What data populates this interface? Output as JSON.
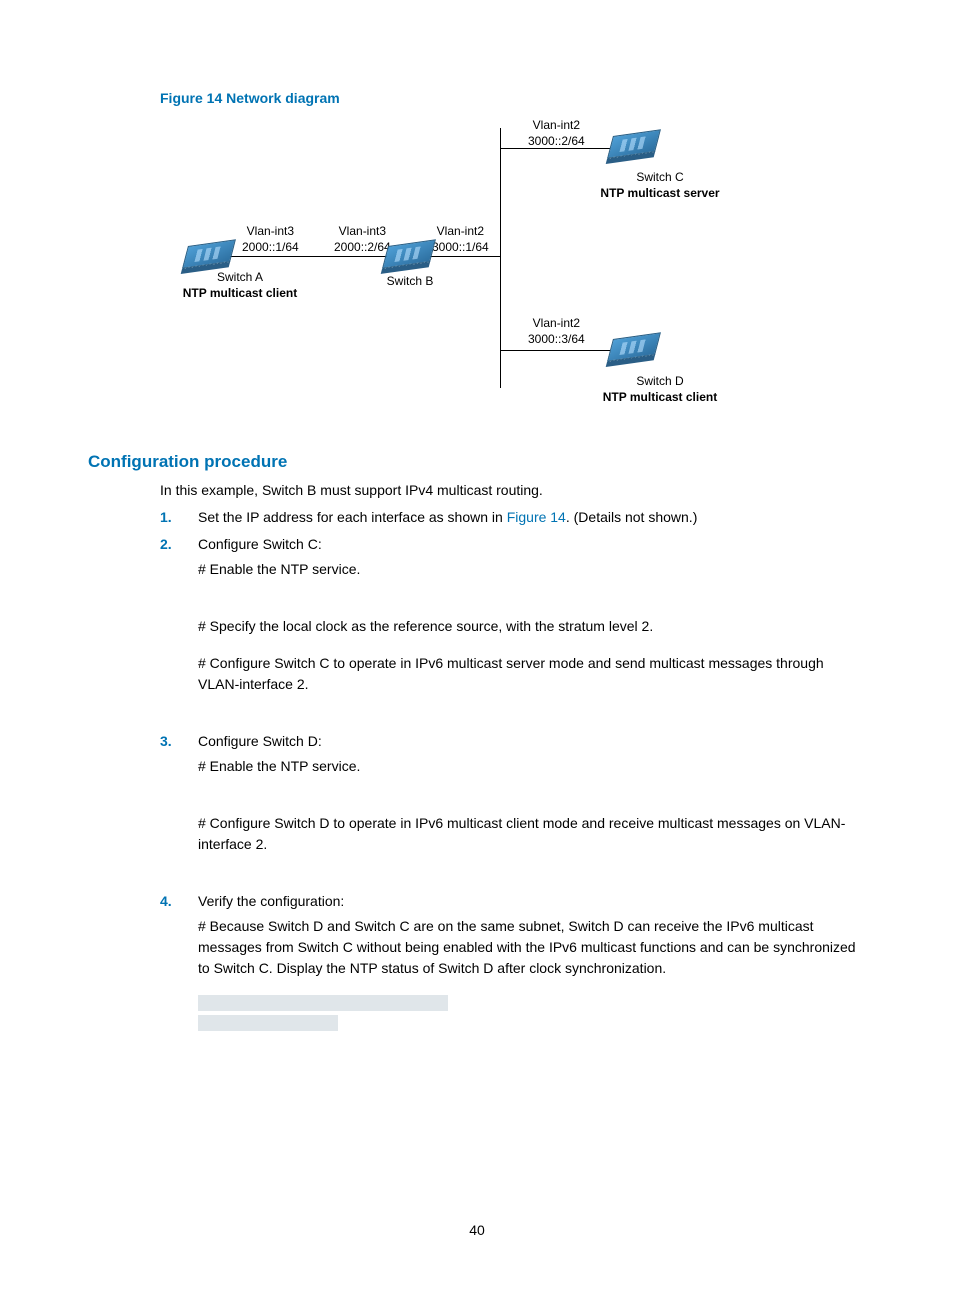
{
  "figure": {
    "label": "Figure 14 Network diagram",
    "nodes": {
      "switchC": {
        "if": "Vlan-int2",
        "addr": "3000::2/64",
        "name": "Switch C",
        "role": "NTP multicast server"
      },
      "switchD": {
        "if": "Vlan-int2",
        "addr": "3000::3/64",
        "name": "Switch D",
        "role": "NTP multicast client"
      },
      "switchA": {
        "if": "Vlan-int3",
        "addr": "2000::1/64",
        "name": "Switch A",
        "role": "NTP multicast client"
      },
      "switchB": {
        "leftIf": "Vlan-int3",
        "leftAddr": "2000::2/64",
        "rightIf": "Vlan-int2",
        "rightAddr": "3000::1/64",
        "name": "Switch B"
      }
    }
  },
  "section": {
    "title": "Configuration procedure"
  },
  "intro": "In this example, Switch B must support IPv4 multicast routing.",
  "steps": [
    {
      "num": "1.",
      "text1a": "Set the IP address for each interface as shown in ",
      "figref": "Figure 14",
      "text1b": ". (Details not shown.)"
    },
    {
      "num": "2.",
      "title": "Configure Switch C:",
      "p1": "# Enable the NTP service.",
      "p2": "# Specify the local clock as the reference source, with the stratum level 2.",
      "p3": "# Configure Switch C to operate in IPv6 multicast server mode and send multicast messages through VLAN-interface 2."
    },
    {
      "num": "3.",
      "title": "Configure Switch D:",
      "p1": "# Enable the NTP service.",
      "p2": "# Configure Switch D to operate in IPv6 multicast client mode and receive multicast messages on VLAN-interface 2."
    },
    {
      "num": "4.",
      "title": "Verify the configuration:",
      "p1": "# Because Switch D and Switch C are on the same subnet, Switch D can receive the IPv6 multicast messages from Switch C without being enabled with the IPv6 multicast functions and can be synchronized to Switch C. Display the NTP status of Switch D after clock synchronization."
    }
  ],
  "pageNumber": "40"
}
